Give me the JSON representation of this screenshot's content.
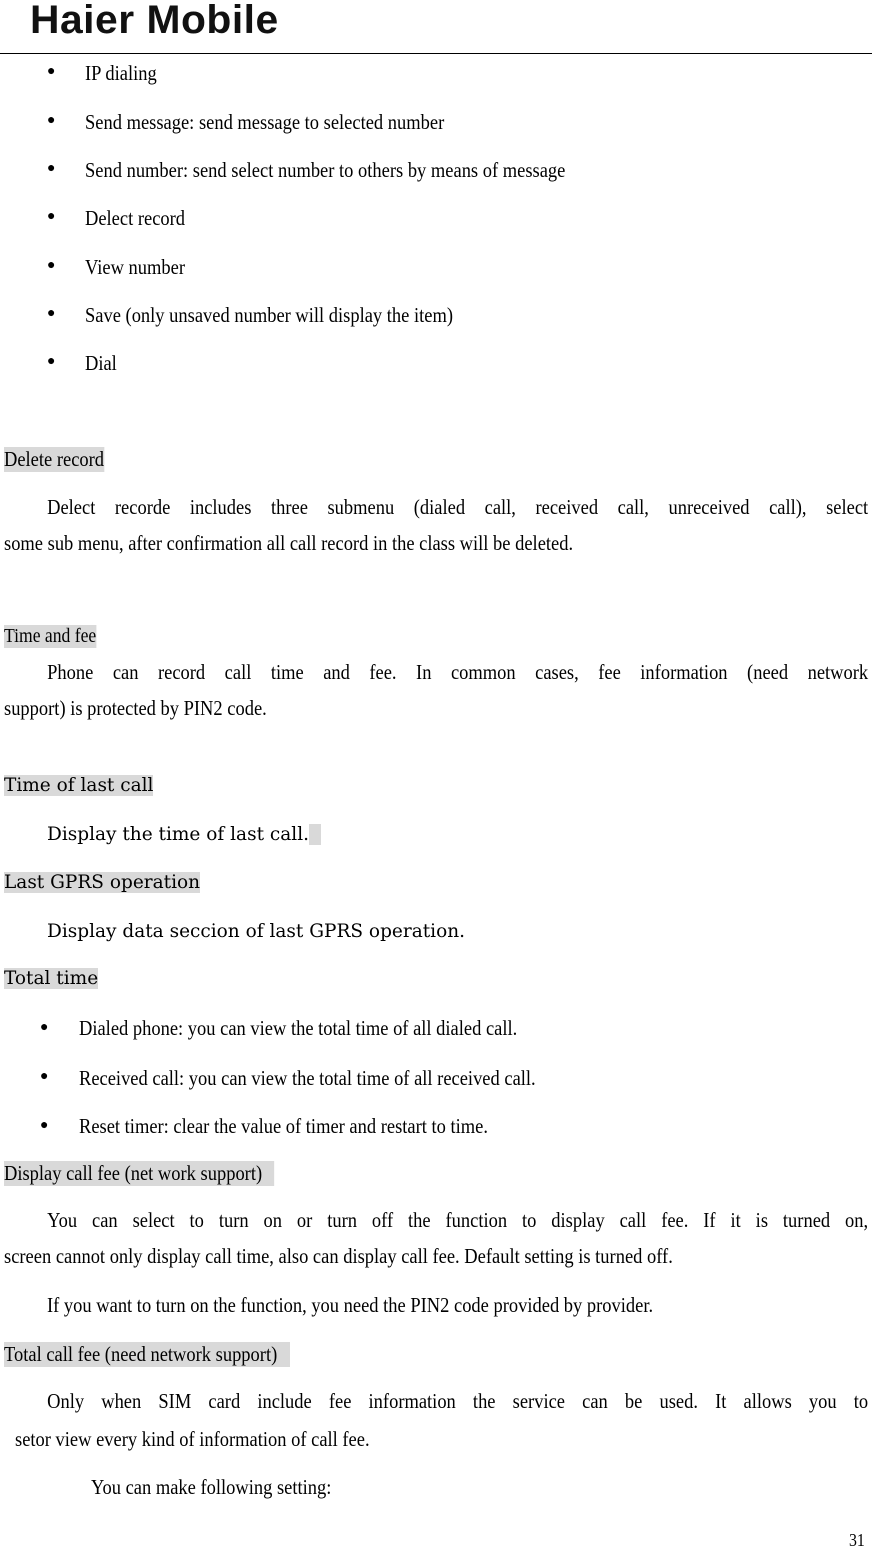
{
  "header": {
    "logo_text": "Haier Mobile"
  },
  "options_list": [
    "IP dialing",
    "Send message: send message to selected number",
    "Send number: send select number to others by means of message",
    "Delect record",
    "View number",
    "Save (only unsaved number will display the item)",
    "Dial"
  ],
  "sections": {
    "delete_record": {
      "heading": "Delete record",
      "line1": "Delect recorde includes three submenu (dialed call, received call, unreceived call), select",
      "line2": "some sub menu, after confirmation all call record in the class will be deleted."
    },
    "time_and_fee": {
      "heading": "Time and fee",
      "line1": "Phone can record call time and fee. In common cases, fee information (need network",
      "line2": "support) is protected by PIN2 code."
    },
    "time_of_last_call": {
      "heading": "Time of last call",
      "body": "Display the time of last call."
    },
    "last_gprs": {
      "heading": "Last GPRS operation",
      "body": "Display data seccion of last GPRS operation."
    },
    "total_time": {
      "heading": "Total time",
      "items": [
        "Dialed phone: you can view the total time of all dialed call.",
        "Received call: you can view the total time of all received call.",
        "Reset timer: clear the value of timer and restart to time."
      ]
    },
    "display_call_fee": {
      "heading": "Display call fee (net work support)",
      "line1": "You can select to turn on or turn off the function to display call fee. If it is turned on,",
      "line2": "screen cannot only display call time, also can display call fee. Default setting is turned off.",
      "line3": "If you want to turn on the function, you need the PIN2 code provided by provider."
    },
    "total_call_fee": {
      "heading": "Total call fee (need network support)",
      "line1": "Only when SIM card include fee information the service can be used. It allows you to",
      "line2": "setor view every kind of information of call fee.",
      "line3": "You can make following setting:"
    }
  },
  "footer": {
    "page_number": "31"
  }
}
